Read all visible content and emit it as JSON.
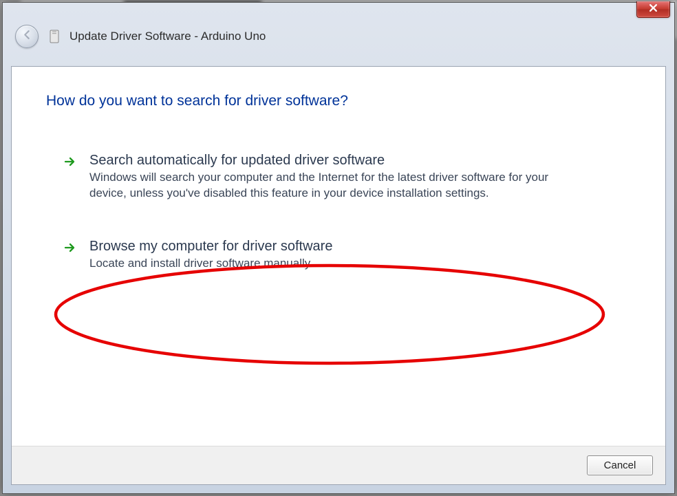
{
  "window": {
    "title": "Update Driver Software - Arduino Uno"
  },
  "heading": "How do you want to search for driver software?",
  "options": [
    {
      "title": "Search automatically for updated driver software",
      "description": "Windows will search your computer and the Internet for the latest driver software for your device, unless you've disabled this feature in your device installation settings."
    },
    {
      "title": "Browse my computer for driver software",
      "description": "Locate and install driver software manually."
    }
  ],
  "buttons": {
    "cancel": "Cancel"
  },
  "colors": {
    "heading": "#003399",
    "annotation": "#e60000"
  }
}
